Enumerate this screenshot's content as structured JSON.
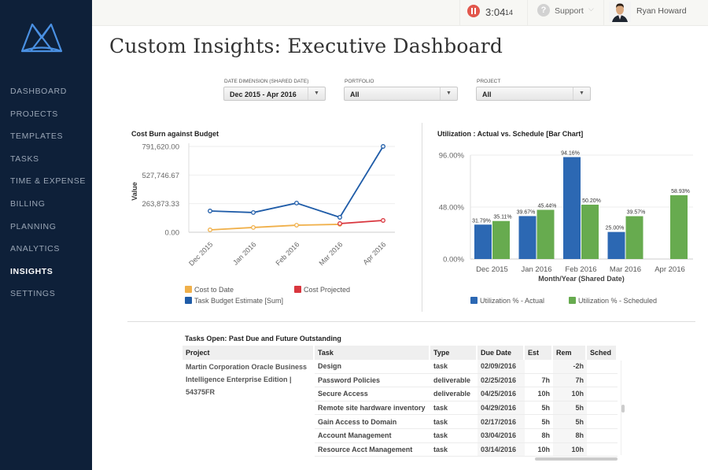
{
  "sidebar": {
    "logo": "mavenlink-logo",
    "items": [
      {
        "label": "DASHBOARD",
        "active": false
      },
      {
        "label": "PROJECTS",
        "active": false
      },
      {
        "label": "TEMPLATES",
        "active": false
      },
      {
        "label": "TASKS",
        "active": false
      },
      {
        "label": "TIME & EXPENSE",
        "active": false
      },
      {
        "label": "BILLING",
        "active": false
      },
      {
        "label": "PLANNING",
        "active": false
      },
      {
        "label": "ANALYTICS",
        "active": false
      },
      {
        "label": "INSIGHTS",
        "active": true
      },
      {
        "label": "SETTINGS",
        "active": false
      }
    ]
  },
  "topbar": {
    "timer": {
      "icon": "pause-icon",
      "time": "3:04",
      "seconds": "14"
    },
    "support": {
      "icon": "question-icon",
      "label": "Support",
      "chevron": "⌵"
    },
    "user": {
      "name": "Ryan Howard"
    }
  },
  "page": {
    "title": "Custom Insights: Executive Dashboard"
  },
  "filters": [
    {
      "label": "DATE DIMENSION (SHARED DATE)",
      "value": "Dec 2015 - Apr 2016"
    },
    {
      "label": "PORTFOLIO",
      "value": "All"
    },
    {
      "label": "PROJECT",
      "value": "All"
    }
  ],
  "chart_data": [
    {
      "type": "line",
      "title": "Cost Burn against Budget",
      "xlabel": "",
      "ylabel": "Value",
      "categories": [
        "Dec 2015",
        "Jan 2016",
        "Feb 2016",
        "Mar 2016",
        "Apr 2016"
      ],
      "yticks": [
        "0.00",
        "263,873.33",
        "527,746.67",
        "791,620.00"
      ],
      "ylim": [
        0,
        791620
      ],
      "grid": true,
      "legend_position": "bottom",
      "series": [
        {
          "name": "Cost to Date",
          "color": "#f0b04a",
          "values": [
            22000,
            44000,
            65000,
            73000,
            null
          ]
        },
        {
          "name": "Cost Projected",
          "color": "#d9363e",
          "values": [
            null,
            null,
            null,
            80000,
            109000
          ]
        },
        {
          "name": "Task Budget Estimate [Sum]",
          "color": "#1f5ca8",
          "values": [
            196000,
            182000,
            269000,
            138000,
            791620
          ]
        }
      ]
    },
    {
      "type": "bar",
      "title": "Utilization : Actual vs. Schedule [Bar Chart]",
      "xlabel": "Month/Year (Shared Date)",
      "ylabel": "",
      "categories": [
        "Dec 2015",
        "Jan 2016",
        "Feb 2016",
        "Mar 2016",
        "Apr 2016"
      ],
      "yticks": [
        "0.00%",
        "48.00%",
        "96.00%"
      ],
      "ylim": [
        0,
        96
      ],
      "grid": true,
      "legend_position": "bottom",
      "series": [
        {
          "name": "Utilization % - Actual",
          "color": "#2c68b3",
          "values": [
            31.79,
            39.67,
            94.16,
            25.0,
            null
          ],
          "labels": [
            "31.79%",
            "39.67%",
            "94.16%",
            "25.00%",
            ""
          ]
        },
        {
          "name": "Utilization % - Scheduled",
          "color": "#67ab4f",
          "values": [
            35.11,
            45.44,
            50.2,
            39.57,
            58.93
          ],
          "labels": [
            "35.11%",
            "45.44%",
            "50.20%",
            "39.57%",
            "58.93%"
          ]
        }
      ]
    }
  ],
  "tasks_table": {
    "title": "Tasks Open: Past Due and Future Outstanding",
    "columns": [
      "Project",
      "Task",
      "Type",
      "Due Date",
      "Est",
      "Rem",
      "Sched"
    ],
    "project": "Martin Corporation Oracle Business Intelligence Enterprise Edition | 54375FR",
    "rows": [
      {
        "task": "Design",
        "type": "task",
        "due": "02/09/2016",
        "est": "",
        "rem": "-2h",
        "sched": ""
      },
      {
        "task": "Password Policies",
        "type": "deliverable",
        "due": "02/25/2016",
        "est": "7h",
        "rem": "7h",
        "sched": ""
      },
      {
        "task": "Secure Access",
        "type": "deliverable",
        "due": "04/25/2016",
        "est": "10h",
        "rem": "10h",
        "sched": ""
      },
      {
        "task": "Remote site hardware inventory",
        "type": "task",
        "due": "04/29/2016",
        "est": "5h",
        "rem": "5h",
        "sched": ""
      },
      {
        "task": "Gain Access to Domain",
        "type": "task",
        "due": "02/17/2016",
        "est": "5h",
        "rem": "5h",
        "sched": ""
      },
      {
        "task": "Account Management",
        "type": "task",
        "due": "03/04/2016",
        "est": "8h",
        "rem": "8h",
        "sched": ""
      },
      {
        "task": "Resource Acct Management",
        "type": "task",
        "due": "03/14/2016",
        "est": "10h",
        "rem": "10h",
        "sched": ""
      }
    ]
  }
}
